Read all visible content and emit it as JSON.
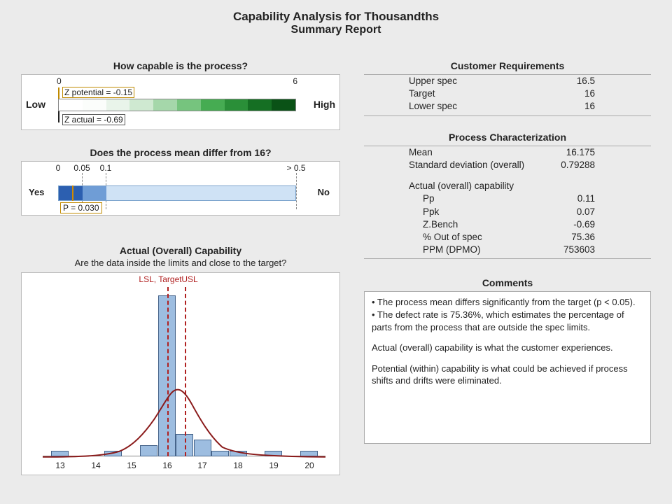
{
  "title": {
    "line1": "Capability Analysis for Thousandths",
    "line2": "Summary Report"
  },
  "capability_panel": {
    "heading": "How capable is the process?",
    "scale_min": "0",
    "scale_max": "6",
    "low_label": "Low",
    "high_label": "High",
    "z_potential_label": "Z potential = -0.15",
    "z_actual_label": "Z actual = -0.69"
  },
  "pvalue_panel": {
    "heading": "Does the process mean differ from 16?",
    "ticks": [
      "0",
      "0.05",
      "0.1",
      "> 0.5"
    ],
    "yes": "Yes",
    "no": "No",
    "p_label": "P = 0.030"
  },
  "hist_panel": {
    "heading": "Actual (Overall) Capability",
    "subheading": "Are the data inside the limits and close to the target?",
    "lsl_target_label": "LSL, Target",
    "usl_label": "USL"
  },
  "customer_req": {
    "heading": "Customer Requirements",
    "rows": [
      {
        "k": "Upper spec",
        "v": "16.5"
      },
      {
        "k": "Target",
        "v": "16"
      },
      {
        "k": "Lower spec",
        "v": "16"
      }
    ]
  },
  "process_char": {
    "heading": "Process Characterization",
    "rows_top": [
      {
        "k": "Mean",
        "v": "16.175"
      },
      {
        "k": "Standard deviation (overall)",
        "v": "0.79288"
      }
    ],
    "subhead": "Actual (overall) capability",
    "rows_cap": [
      {
        "k": "Pp",
        "v": "0.11"
      },
      {
        "k": "Ppk",
        "v": "0.07"
      },
      {
        "k": "Z.Bench",
        "v": "-0.69"
      },
      {
        "k": "% Out of spec",
        "v": "75.36"
      },
      {
        "k": "PPM (DPMO)",
        "v": "753603"
      }
    ]
  },
  "comments": {
    "heading": "Comments",
    "bullet1": "•  The process mean differs significantly from the target (p < 0.05).",
    "bullet2": "•  The defect rate is 75.36%, which estimates the percentage of parts from the process that are outside the spec limits.",
    "para1": "Actual (overall) capability is what the customer experiences.",
    "para2": "Potential (within) capability is what could be achieved if process shifts and drifts were eliminated."
  },
  "chart_data": [
    {
      "type": "bar",
      "name": "capability_scale",
      "title": "How capable is the process?",
      "x_range": [
        0,
        6
      ],
      "z_potential": -0.15,
      "z_actual": -0.69,
      "low_label": "Low",
      "high_label": "High"
    },
    {
      "type": "bar",
      "name": "pvalue_scale",
      "title": "Does the process mean differ from 16?",
      "ticks": [
        0,
        0.05,
        0.1,
        0.5
      ],
      "p_value": 0.03,
      "yes_no_labels": [
        "Yes",
        "No"
      ]
    },
    {
      "type": "bar",
      "name": "histogram",
      "title": "Actual (Overall) Capability",
      "subtitle": "Are the data inside the limits and close to the target?",
      "x": [
        13,
        13.5,
        14,
        14.5,
        15,
        15.5,
        16,
        16.5,
        17,
        17.5,
        18,
        18.5,
        19,
        19.5,
        20
      ],
      "counts": [
        1,
        0,
        0,
        1,
        0,
        2,
        29,
        4,
        3,
        1,
        1,
        0,
        1,
        0,
        1
      ],
      "spec_lines": {
        "LSL": 16,
        "Target": 16,
        "USL": 16.5
      },
      "normal_curve": {
        "mean": 16.175,
        "sd": 0.79288
      },
      "x_ticks": [
        13,
        14,
        15,
        16,
        17,
        18,
        19,
        20
      ]
    }
  ]
}
